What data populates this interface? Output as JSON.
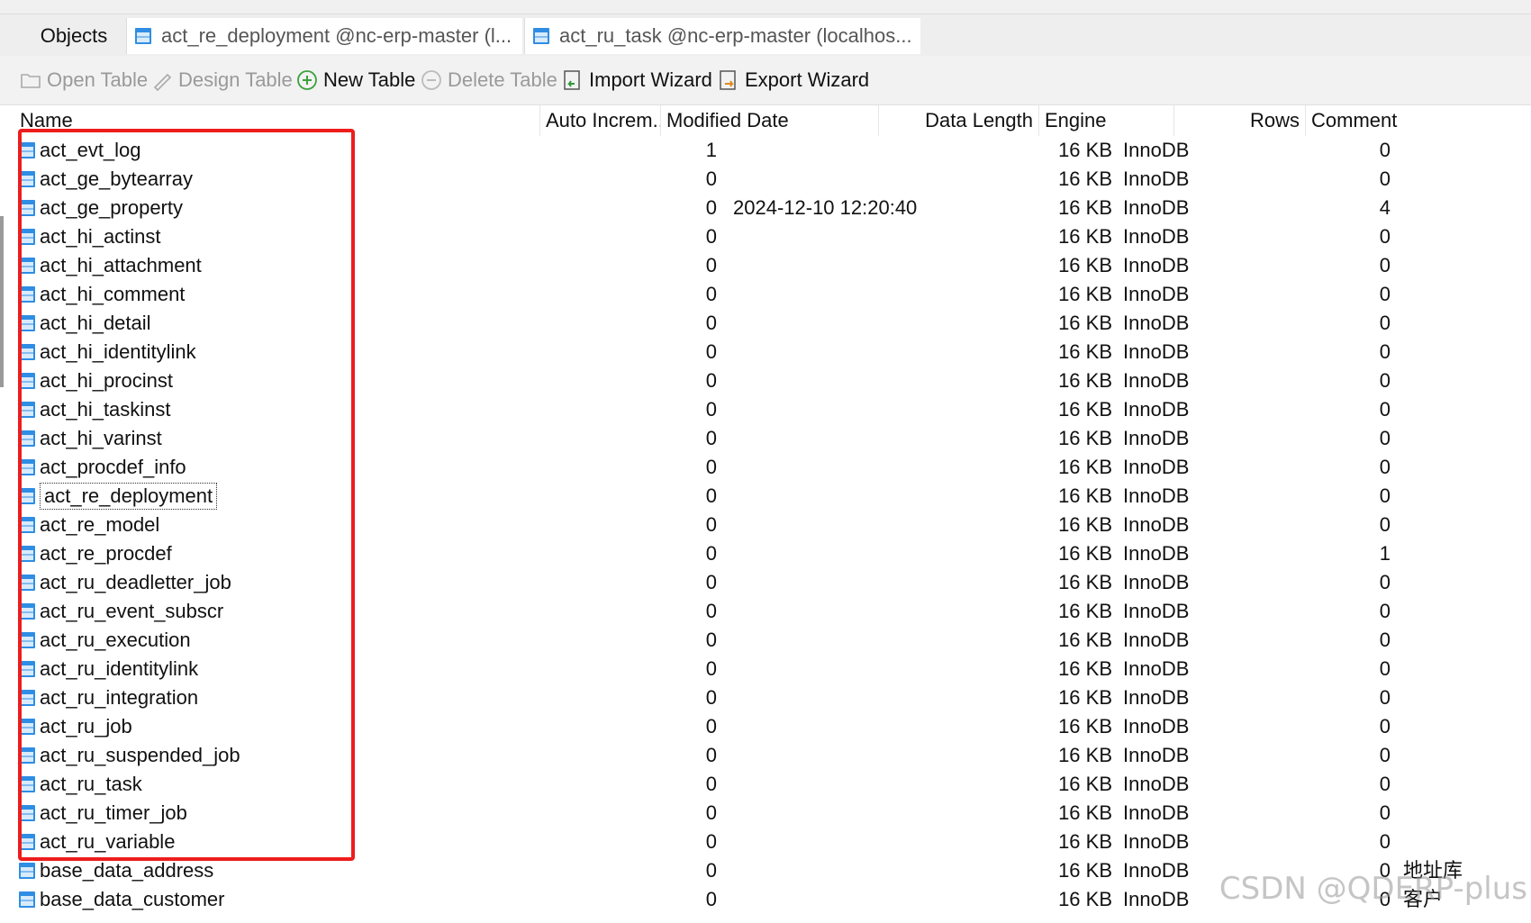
{
  "tabs": {
    "objects": "Objects",
    "tab1": "act_re_deployment @nc-erp-master (l...",
    "tab2": "act_ru_task @nc-erp-master (localhos..."
  },
  "toolbar": {
    "open_table": "Open Table",
    "design_table": "Design Table",
    "new_table": "New Table",
    "delete_table": "Delete Table",
    "import_wizard": "Import Wizard",
    "export_wizard": "Export Wizard"
  },
  "columns": {
    "name": "Name",
    "auto_increment": "Auto Increm...",
    "modified_date": "Modified Date",
    "data_length": "Data Length",
    "engine": "Engine",
    "rows": "Rows",
    "comment": "Comment"
  },
  "tables": [
    {
      "name": "act_evt_log",
      "auto": "1",
      "modified": "",
      "length": "16 KB",
      "engine": "InnoDB",
      "rows": "0",
      "comment": ""
    },
    {
      "name": "act_ge_bytearray",
      "auto": "0",
      "modified": "",
      "length": "16 KB",
      "engine": "InnoDB",
      "rows": "0",
      "comment": ""
    },
    {
      "name": "act_ge_property",
      "auto": "0",
      "modified": "2024-12-10 12:20:40",
      "length": "16 KB",
      "engine": "InnoDB",
      "rows": "4",
      "comment": ""
    },
    {
      "name": "act_hi_actinst",
      "auto": "0",
      "modified": "",
      "length": "16 KB",
      "engine": "InnoDB",
      "rows": "0",
      "comment": ""
    },
    {
      "name": "act_hi_attachment",
      "auto": "0",
      "modified": "",
      "length": "16 KB",
      "engine": "InnoDB",
      "rows": "0",
      "comment": ""
    },
    {
      "name": "act_hi_comment",
      "auto": "0",
      "modified": "",
      "length": "16 KB",
      "engine": "InnoDB",
      "rows": "0",
      "comment": ""
    },
    {
      "name": "act_hi_detail",
      "auto": "0",
      "modified": "",
      "length": "16 KB",
      "engine": "InnoDB",
      "rows": "0",
      "comment": ""
    },
    {
      "name": "act_hi_identitylink",
      "auto": "0",
      "modified": "",
      "length": "16 KB",
      "engine": "InnoDB",
      "rows": "0",
      "comment": ""
    },
    {
      "name": "act_hi_procinst",
      "auto": "0",
      "modified": "",
      "length": "16 KB",
      "engine": "InnoDB",
      "rows": "0",
      "comment": ""
    },
    {
      "name": "act_hi_taskinst",
      "auto": "0",
      "modified": "",
      "length": "16 KB",
      "engine": "InnoDB",
      "rows": "0",
      "comment": ""
    },
    {
      "name": "act_hi_varinst",
      "auto": "0",
      "modified": "",
      "length": "16 KB",
      "engine": "InnoDB",
      "rows": "0",
      "comment": ""
    },
    {
      "name": "act_procdef_info",
      "auto": "0",
      "modified": "",
      "length": "16 KB",
      "engine": "InnoDB",
      "rows": "0",
      "comment": ""
    },
    {
      "name": "act_re_deployment",
      "auto": "0",
      "modified": "",
      "length": "16 KB",
      "engine": "InnoDB",
      "rows": "0",
      "comment": "",
      "selected": true
    },
    {
      "name": "act_re_model",
      "auto": "0",
      "modified": "",
      "length": "16 KB",
      "engine": "InnoDB",
      "rows": "0",
      "comment": ""
    },
    {
      "name": "act_re_procdef",
      "auto": "0",
      "modified": "",
      "length": "16 KB",
      "engine": "InnoDB",
      "rows": "1",
      "comment": ""
    },
    {
      "name": "act_ru_deadletter_job",
      "auto": "0",
      "modified": "",
      "length": "16 KB",
      "engine": "InnoDB",
      "rows": "0",
      "comment": ""
    },
    {
      "name": "act_ru_event_subscr",
      "auto": "0",
      "modified": "",
      "length": "16 KB",
      "engine": "InnoDB",
      "rows": "0",
      "comment": ""
    },
    {
      "name": "act_ru_execution",
      "auto": "0",
      "modified": "",
      "length": "16 KB",
      "engine": "InnoDB",
      "rows": "0",
      "comment": ""
    },
    {
      "name": "act_ru_identitylink",
      "auto": "0",
      "modified": "",
      "length": "16 KB",
      "engine": "InnoDB",
      "rows": "0",
      "comment": ""
    },
    {
      "name": "act_ru_integration",
      "auto": "0",
      "modified": "",
      "length": "16 KB",
      "engine": "InnoDB",
      "rows": "0",
      "comment": ""
    },
    {
      "name": "act_ru_job",
      "auto": "0",
      "modified": "",
      "length": "16 KB",
      "engine": "InnoDB",
      "rows": "0",
      "comment": ""
    },
    {
      "name": "act_ru_suspended_job",
      "auto": "0",
      "modified": "",
      "length": "16 KB",
      "engine": "InnoDB",
      "rows": "0",
      "comment": ""
    },
    {
      "name": "act_ru_task",
      "auto": "0",
      "modified": "",
      "length": "16 KB",
      "engine": "InnoDB",
      "rows": "0",
      "comment": ""
    },
    {
      "name": "act_ru_timer_job",
      "auto": "0",
      "modified": "",
      "length": "16 KB",
      "engine": "InnoDB",
      "rows": "0",
      "comment": ""
    },
    {
      "name": "act_ru_variable",
      "auto": "0",
      "modified": "",
      "length": "16 KB",
      "engine": "InnoDB",
      "rows": "0",
      "comment": ""
    },
    {
      "name": "base_data_address",
      "auto": "0",
      "modified": "",
      "length": "16 KB",
      "engine": "InnoDB",
      "rows": "0",
      "comment": "地址库"
    },
    {
      "name": "base_data_customer",
      "auto": "0",
      "modified": "",
      "length": "16 KB",
      "engine": "InnoDB",
      "rows": "0",
      "comment": "客户"
    }
  ],
  "watermark": "CSDN @QDERP-plus",
  "colors": {
    "highlight": "#ee1c1c",
    "table_icon": "#2f8de4"
  }
}
